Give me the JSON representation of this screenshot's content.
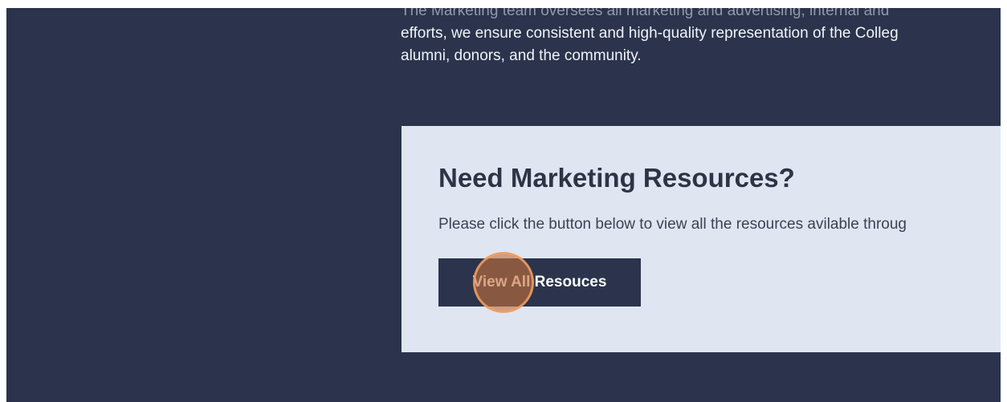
{
  "intro": {
    "line_clipped": "The Marketing team oversees all marketing and advertising, internal and",
    "line_1": "efforts, we ensure consistent and high-quality representation of the Colleg",
    "line_2": "alumni, donors, and the community."
  },
  "card": {
    "heading": "Need Marketing Resources?",
    "text": "Please click the button below to view all the resources avilable throug",
    "button_label": "View All Resouces"
  },
  "colors": {
    "page_background": "#2b344c",
    "card_background": "#dfe6f2",
    "button_background": "#2b344c",
    "click_indicator": "#c4703a"
  }
}
